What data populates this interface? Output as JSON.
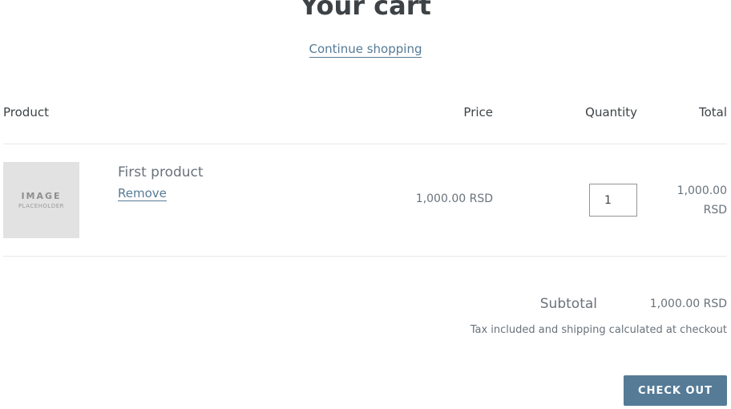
{
  "page": {
    "title": "Your cart",
    "continue_link": "Continue shopping"
  },
  "table": {
    "headers": {
      "product": "Product",
      "price": "Price",
      "quantity": "Quantity",
      "total": "Total"
    },
    "items": [
      {
        "image_placeholder_line1": "IMAGE",
        "image_placeholder_line2": "PLACEHOLDER",
        "name": "First product",
        "remove_label": "Remove",
        "price": "1,000.00 RSD",
        "quantity": "1",
        "total_line1": "1,000.00",
        "total_line2": "RSD"
      }
    ]
  },
  "summary": {
    "subtotal_label": "Subtotal",
    "subtotal_value": "1,000.00 RSD",
    "tax_note": "Tax included and shipping calculated at checkout",
    "checkout_label": "CHECK OUT"
  },
  "colors": {
    "accent": "#557b97",
    "text": "#3d4246",
    "muted_text": "#69727b",
    "divider": "#e8e9eb",
    "placeholder_bg": "#e2e2e2"
  }
}
